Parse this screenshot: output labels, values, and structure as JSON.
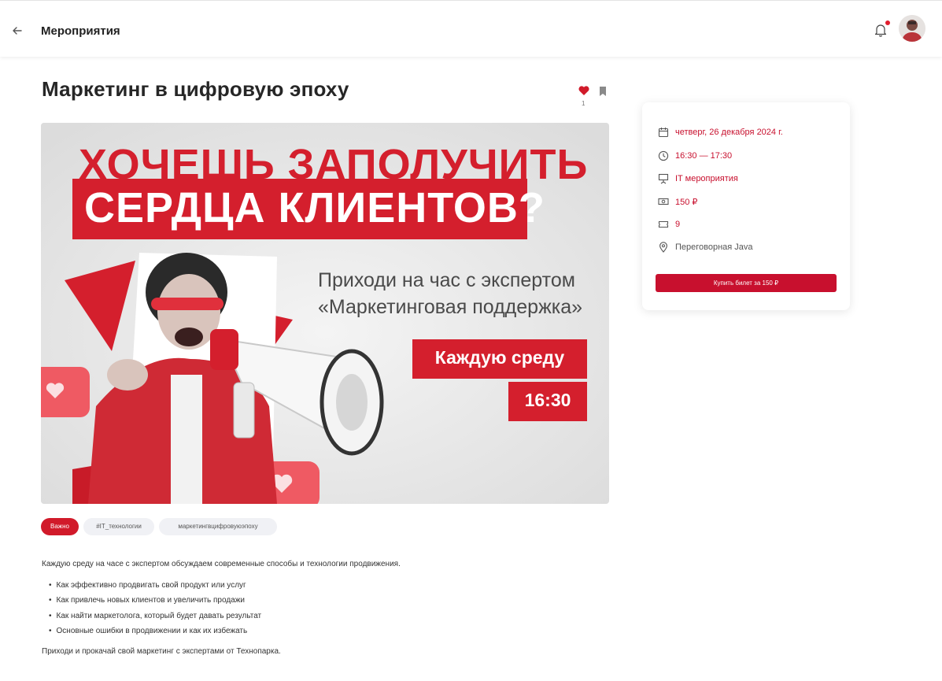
{
  "header": {
    "title": "Мероприятия",
    "back_icon": "arrow-left-icon",
    "notification_icon": "bell-icon",
    "notification_dot_color": "#e11d2e"
  },
  "event": {
    "title": "Маркетинг в цифровую эпоху",
    "likes": "1",
    "like_icon": "heart-icon",
    "bookmark_icon": "bookmark-icon"
  },
  "banner": {
    "headline_line1": "ХОЧЕШЬ ЗАПОЛУЧИТЬ",
    "headline_line2": "СЕРДЦА КЛИЕНТОВ?",
    "subtitle_line1": "Приходи на час с экспертом",
    "subtitle_line2": "«Маркетинговая поддержка»",
    "day": "Каждую среду",
    "time": "16:30",
    "accent_color": "#d41f2d"
  },
  "tags": [
    "Важно",
    "#IT_технологии",
    "маркетингвцифровуюэпоху"
  ],
  "description": {
    "intro": "Каждую среду на часе с экспертом обсуждаем современные способы и технологии продвижения.",
    "bullets": [
      "Как эффективно продвигать свой продукт или услуг",
      "Как привлечь новых клиентов и увеличить продажи",
      "Как найти маркетолога, который будет давать результат",
      "Основные ошибки в продвижении и как их избежать"
    ],
    "outro": "Приходи и прокачай свой маркетинг с экспертами от Технопарка."
  },
  "details": {
    "date": "четверг, 26 декабря 2024 г.",
    "time": "16:30 — 17:30",
    "category": "IT мероприятия",
    "price": "150 ₽",
    "tickets": "9",
    "location": "Переговорная Java",
    "buy_button": "Купить билет за 150 ₽",
    "accent_color": "#c8102e"
  }
}
